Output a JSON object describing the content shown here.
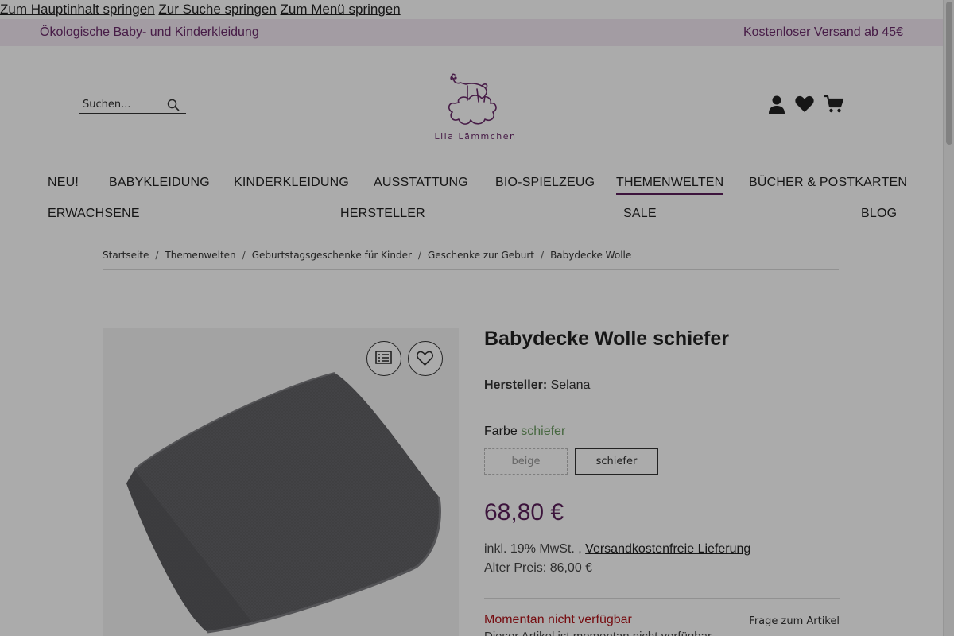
{
  "skip_links": [
    "Zum Hauptinhalt springen",
    "Zur Suche springen",
    "Zum Menü springen"
  ],
  "topbar": {
    "tagline": "Ökologische Baby- und Kinderkleidung",
    "shipping": "Kostenloser Versand ab 45€",
    "bg_color": "#f4e9f4",
    "text_color": "#6a2a6a"
  },
  "search": {
    "placeholder": "Suchen...",
    "icon": "search-icon"
  },
  "logo": {
    "text": "Lila Lämmchen",
    "icon": "lamb-on-cloud-logo"
  },
  "header_icons": [
    "account-icon",
    "wishlist-heart-icon",
    "cart-icon"
  ],
  "nav": {
    "items": [
      "NEU!",
      "BABYKLEIDUNG",
      "KINDERKLEIDUNG",
      "AUSSTATTUNG",
      "BIO-SPIELZEUG",
      "THEMENWELTEN",
      "BÜCHER & POSTKARTEN",
      "ERWACHSENE",
      "HERSTELLER",
      "SALE",
      "BLOG"
    ],
    "active": "THEMENWELTEN"
  },
  "breadcrumb": [
    "Startseite",
    "Themenwelten",
    "Geburtstagsgeschenke für Kinder",
    "Geschenke zur Geburt",
    "Babydecke Wolle"
  ],
  "gallery": {
    "buttons": [
      "compare-list-icon",
      "wishlist-heart-icon"
    ]
  },
  "product": {
    "title": "Babydecke Wolle schiefer",
    "manufacturer_label": "Hersteller:",
    "manufacturer": "Selana",
    "color_label": "Farbe",
    "color_value": "schiefer",
    "variants": [
      "beige",
      "schiefer"
    ],
    "selected_variant": "schiefer",
    "price": "68,80 €",
    "tax_text": "inkl. 19% MwSt. ,",
    "shipping_link": "Versandkostenfreie Lieferung",
    "old_price": "Alter Preis: 86,00 €",
    "availability": "Momentan nicht verfügbar",
    "question_link": "Frage zum Artikel",
    "below_availability": "Dieser Artikel ist momentan nicht verfügbar",
    "price_color": "#5a1f5a",
    "availability_color": "#b0141a",
    "color_value_color": "#6a9b60"
  }
}
